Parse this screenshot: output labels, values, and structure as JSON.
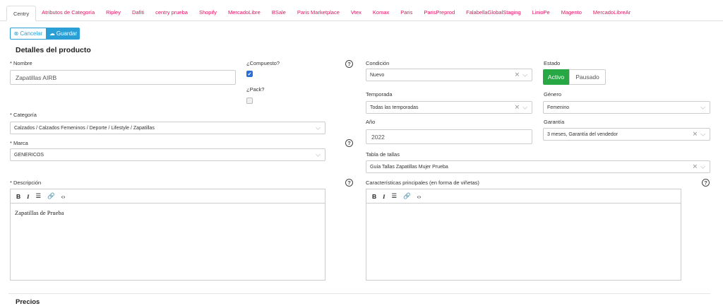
{
  "tabs": [
    "Centry",
    "Atributos de Categoría",
    "Ripley",
    "Dafiti",
    "centry prueba",
    "Shopify",
    "MercadoLibre",
    "BSale",
    "Paris Marketplace",
    "Vtex",
    "Komax",
    "Paris",
    "ParisPreprod",
    "FalabellaGlobalStaging",
    "LinioPe",
    "Magento",
    "MercadoLibreAr"
  ],
  "actions": {
    "cancel": "Cancelar",
    "save": "Guardar"
  },
  "section_title": "Detalles del producto",
  "fields": {
    "nombre": {
      "label": "* Nombre",
      "value": "Zapatillas AIRB"
    },
    "compuesto": {
      "label": "¿Compuesto?",
      "checked": true
    },
    "pack": {
      "label": "¿Pack?",
      "checked": false
    },
    "condicion": {
      "label": "Condición",
      "value": "Nuevo"
    },
    "estado": {
      "label": "Estado",
      "active": "Activo",
      "paused": "Pausado",
      "selected": "Activo"
    },
    "temporada": {
      "label": "Temporada",
      "value": "Todas las temporadas"
    },
    "genero": {
      "label": "Género",
      "value": "Femenino"
    },
    "categoria": {
      "label": "* Categoría",
      "value": "Calzados / Calzados Femeninos / Deporte / Lifestyle / Zapatillas"
    },
    "anio": {
      "label": "Año",
      "value": "2022"
    },
    "garantia": {
      "label": "Garantía",
      "value": "3 meses, Garantía del vendedor"
    },
    "marca": {
      "label": "* Marca",
      "value": "GENERICOS"
    },
    "tabla_tallas": {
      "label": "Tabla de tallas",
      "value": "Guía Tallas Zapatillas Mujer Prueba"
    },
    "descripcion": {
      "label": "* Descripción",
      "value": "Zapatillas de Prueba"
    },
    "caracteristicas": {
      "label": "Características principales (en forma de viñetas)",
      "value": ""
    }
  },
  "next_section": "Precios",
  "colors": {
    "accent": "#2a9fd6",
    "tab_link": "#e0115f",
    "active_green": "#28a745"
  }
}
